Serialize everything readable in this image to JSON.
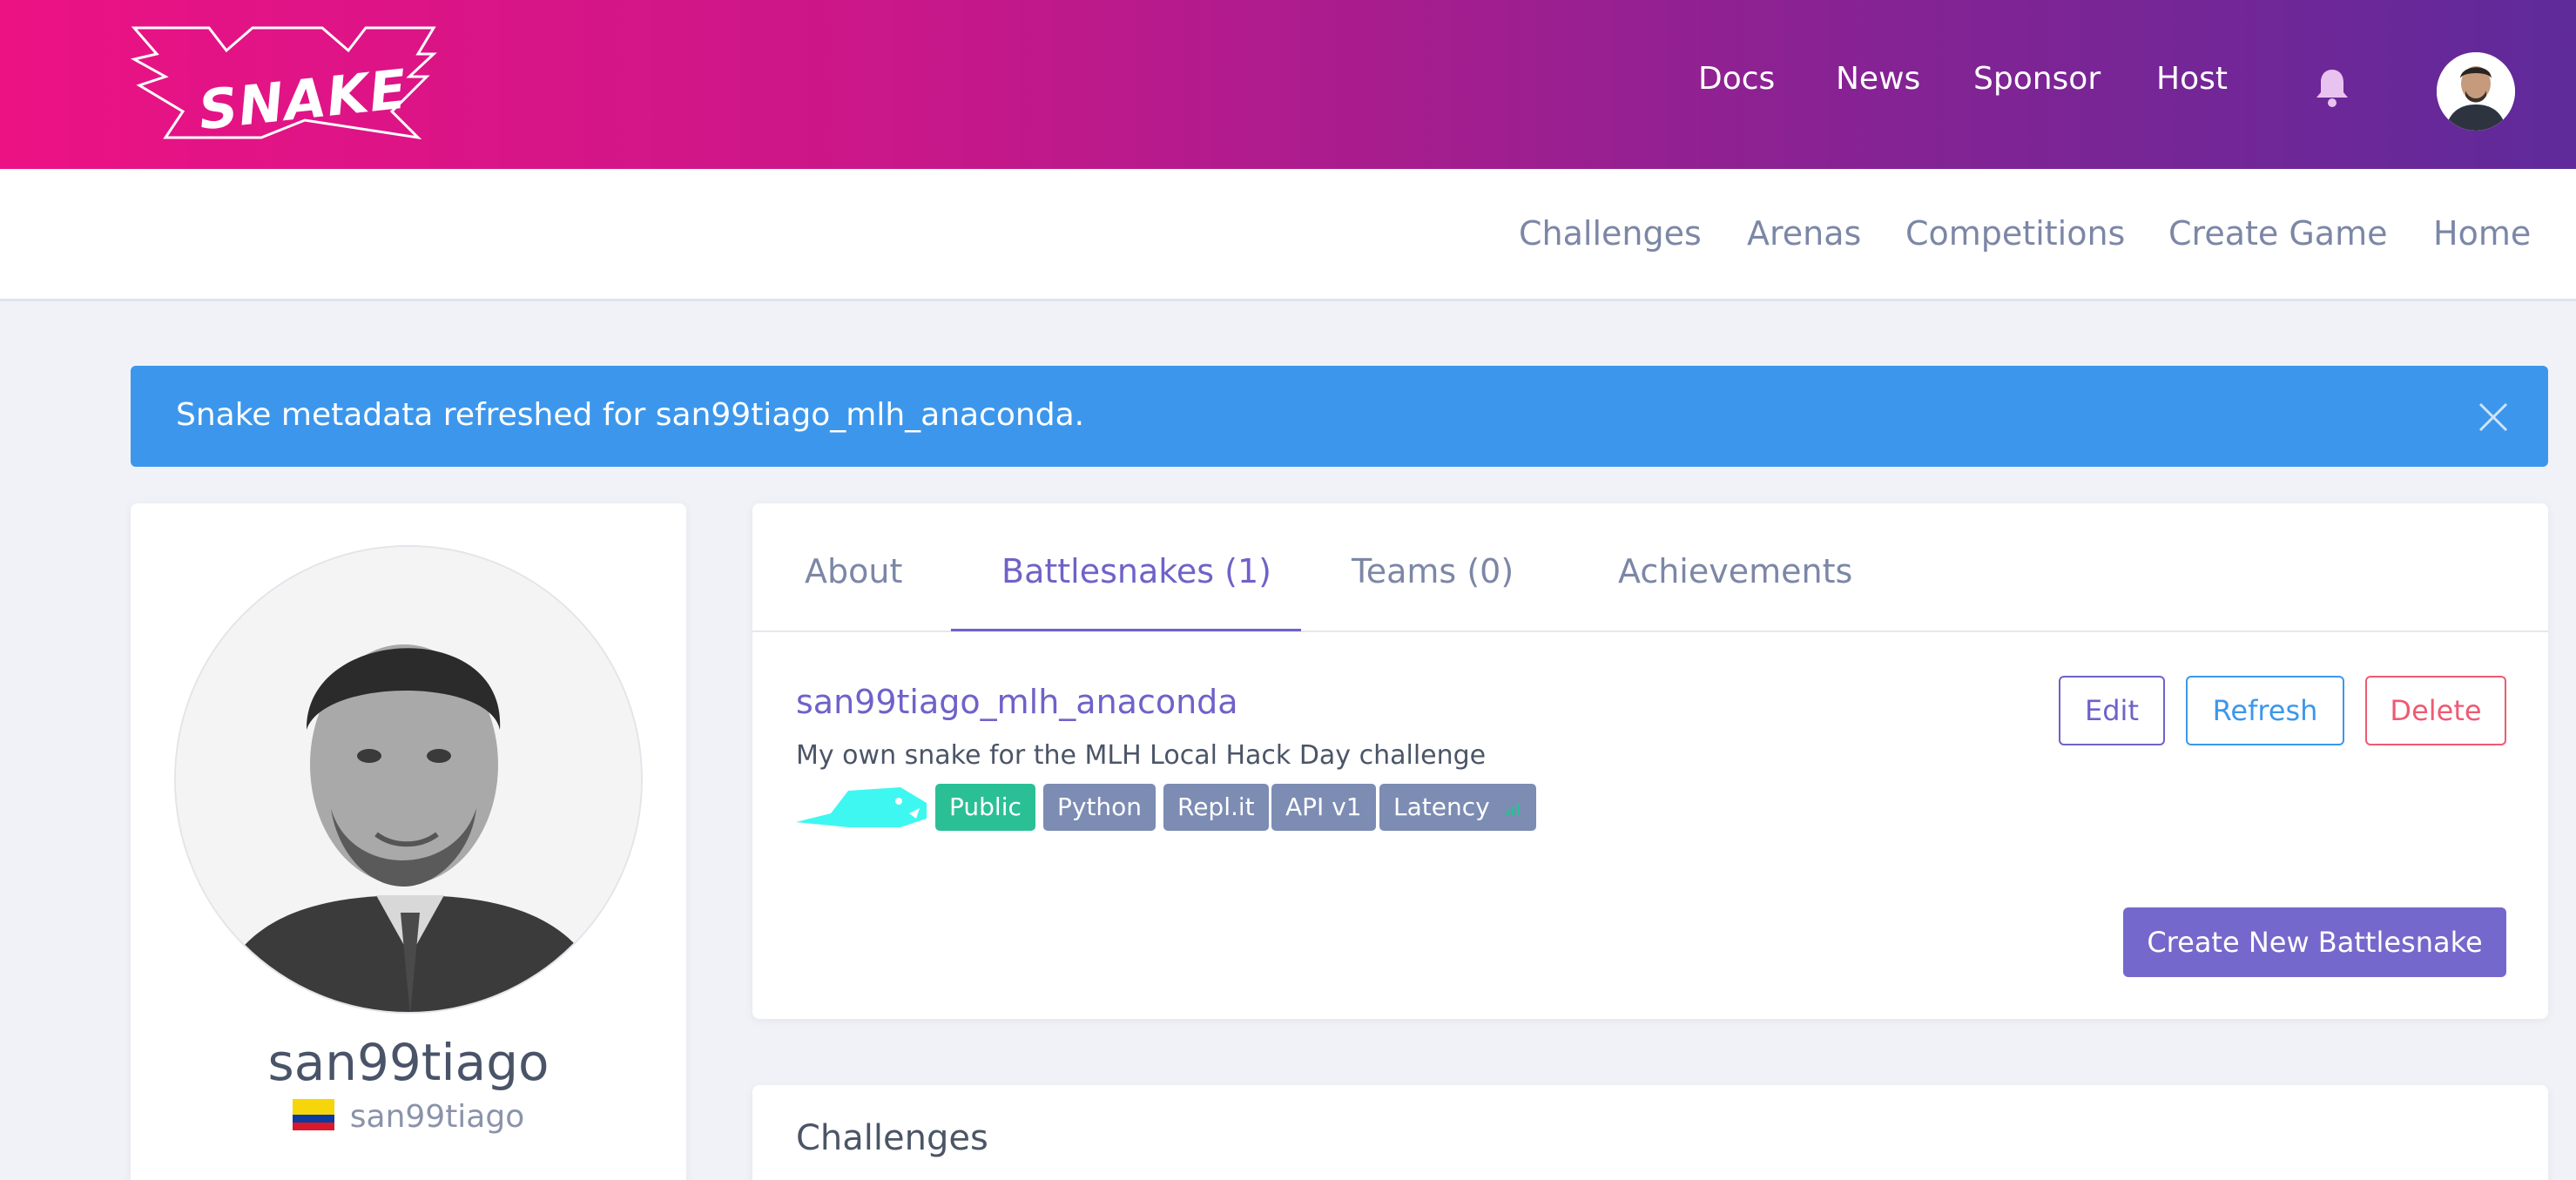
{
  "header": {
    "logo_text": "SNAKE",
    "nav": [
      "Docs",
      "News",
      "Sponsor",
      "Host"
    ],
    "icons": {
      "notifications": "bell-icon",
      "user": "avatar"
    }
  },
  "subnav": {
    "items": [
      "Challenges",
      "Arenas",
      "Competitions",
      "Create Game",
      "Home"
    ]
  },
  "alert": {
    "text": "Snake metadata refreshed for san99tiago_mlh_anaconda.",
    "close_icon": "close-icon"
  },
  "profile": {
    "name": "san99tiago",
    "username": "san99tiago",
    "flag": "colombia-flag"
  },
  "tabs": [
    {
      "label": "About"
    },
    {
      "label": "Battlesnakes (1)"
    },
    {
      "label": "Teams (0)"
    },
    {
      "label": "Achievements"
    }
  ],
  "snake": {
    "name": "san99tiago_mlh_anaconda",
    "description": "My own snake for the MLH Local Hack Day challenge",
    "badges": [
      "Public",
      "Python",
      "Repl.it",
      "API v1",
      "Latency"
    ]
  },
  "actions": {
    "edit": "Edit",
    "refresh": "Refresh",
    "delete": "Delete",
    "create": "Create New Battlesnake"
  },
  "sections": {
    "challenges_title": "Challenges"
  },
  "colors": {
    "accent": "#6e62c9",
    "alert": "#3c97ec",
    "public_badge": "#2bbf96",
    "badge": "#7c8cb3",
    "delete": "#ee5a73"
  }
}
